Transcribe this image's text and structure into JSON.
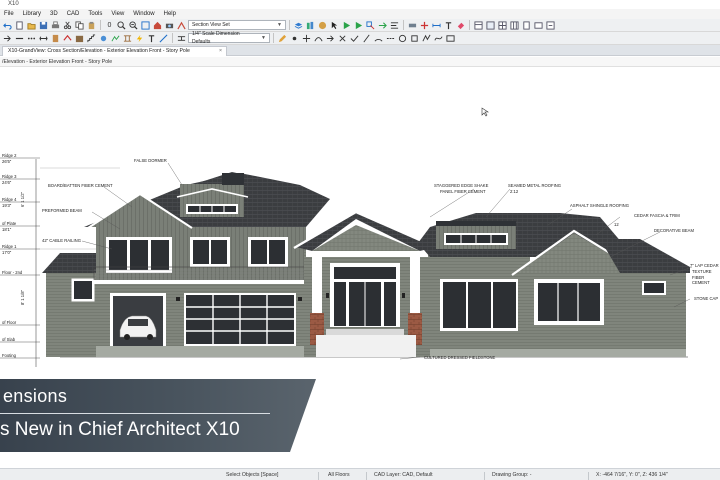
{
  "window": {
    "title": "X10"
  },
  "menu": [
    "File",
    "Library",
    "3D",
    "CAD",
    "Tools",
    "View",
    "Window",
    "Help"
  ],
  "toolbar": {
    "view_set_select": "Section View Set",
    "dimension_defaults_select": "1/4\" Scale Dimension Defaults",
    "counter": "0"
  },
  "tab": {
    "label": "X10-GrandView: Cross Section/Elevation - Exterior Elevation Front - Story Pole",
    "close": "×"
  },
  "view_title": "/Elevation - Exterior Elevation Front - Story Pole",
  "story_pole": [
    {
      "name": "Ridge 2",
      "value": "26'5\""
    },
    {
      "name": "Ridge 3",
      "value": "24'6\""
    },
    {
      "name": "Ridge 4",
      "value": "19'3\""
    },
    {
      "name": "of Plate",
      "value": "18'1\""
    },
    {
      "name": "Ridge 1",
      "value": "17'0\""
    },
    {
      "name": "Floor - 2nd",
      "value": ""
    },
    {
      "name": "of Floor",
      "value": ""
    },
    {
      "name": "of Slab",
      "value": ""
    },
    {
      "name": "Footing",
      "value": ""
    }
  ],
  "story_heights": [
    "6' 1 1/2\"",
    "8' 1 1/8\""
  ],
  "annotations": {
    "false_dormer": "FALSE DORMER",
    "board_batten": "BOARD/BATTEN FIBER CEMENT",
    "preformed_beam": "PREFORMED BEAM",
    "cable_railing": "42\" CABLE RAILING",
    "staggered_edge": "STAGGERED EDGE SHAKE",
    "panel_fiber": "PANEL FIBER CEMENT",
    "seamed_metal": "SEAMED METAL ROOFING",
    "pitch_metal": "2:12",
    "asphalt": "ASPHALT SHINGLE ROOFING",
    "cedar_fascia": "CEDAR FASCIA & TRIM",
    "decorative_beam": "DECORATIVE BEAM",
    "lap_cedar_1": "7\" LAP CEDAR",
    "lap_cedar_2": "TEXTURE",
    "lap_cedar_3": "FIBER CEMENT",
    "stone_cap": "STONE CAP",
    "cultured_stone": "CULTURED DRESSED FIELDSTONE",
    "pitch_value": "12"
  },
  "banner": {
    "title": "ensions",
    "subtitle": "s New in Chief Architect X10"
  },
  "status": {
    "select": "Select Objects [Space]",
    "floors": "All Floors",
    "layer": "CAD Layer: CAD,  Default",
    "group": "Drawing Group: -",
    "coords": "X: -464 7/16\", Y: 0\", Z: 436 1/4\""
  },
  "colors": {
    "roof": "#3b3d40",
    "siding": "#767b73",
    "trim": "#ffffff",
    "stone": "#9b5a44",
    "banner": "#3f4953"
  }
}
